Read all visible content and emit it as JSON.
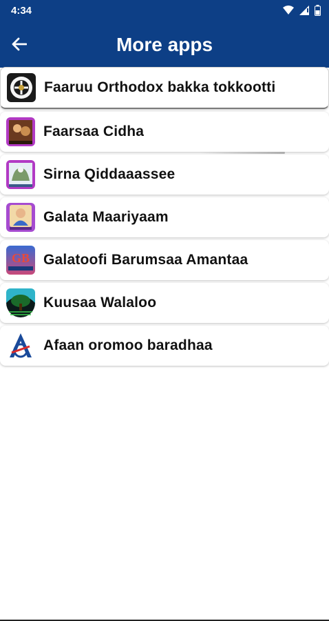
{
  "status_bar": {
    "time": "4:34",
    "icons": [
      "wifi-icon",
      "signal-icon",
      "battery-icon"
    ]
  },
  "app_bar": {
    "back_icon": "arrow-left-icon",
    "title": "More apps",
    "background": "#0d3f86"
  },
  "apps": [
    {
      "label": "Faaruu Orthodox bakka tokkootti",
      "icon": "orthodox-cross-icon"
    },
    {
      "label": "Faarsaa Cidha",
      "icon": "faarsaa-cidha-icon"
    },
    {
      "label": "Sirna Qiddaaassee",
      "icon": "sirna-qiddaassee-icon"
    },
    {
      "label": "Galata Maariyaam",
      "icon": "galata-maariyaam-icon"
    },
    {
      "label": "Galatoofi Barumsaa Amantaa",
      "icon": "gb-icon"
    },
    {
      "label": "Kuusaa Walaloo",
      "icon": "kuusaa-walaloo-icon"
    },
    {
      "label": "Afaan oromoo baradhaa",
      "icon": "afaan-oromoo-icon"
    }
  ]
}
